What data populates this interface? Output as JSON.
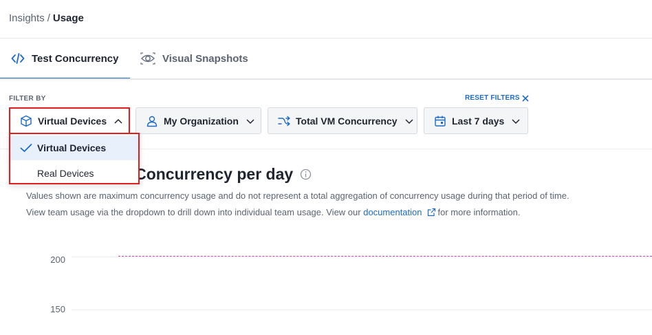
{
  "breadcrumb": {
    "parent": "Insights",
    "separator": "/",
    "current": "Usage"
  },
  "tabs": [
    {
      "label": "Test Concurrency",
      "icon": "code-icon",
      "active": true
    },
    {
      "label": "Visual Snapshots",
      "icon": "eye-icon",
      "active": false
    }
  ],
  "filters": {
    "heading": "FILTER BY",
    "reset_label": "RESET FILTERS",
    "device": {
      "label": "Virtual Devices",
      "icon": "cube-icon",
      "expanded": true
    },
    "org": {
      "label": "My Organization",
      "icon": "user-icon"
    },
    "metric": {
      "label": "Total VM Concurrency",
      "icon": "shuffle-icon"
    },
    "date": {
      "label": "Last 7 days",
      "icon": "calendar-icon"
    }
  },
  "device_dropdown": {
    "options": [
      {
        "label": "Virtual Devices",
        "selected": true
      },
      {
        "label": "Real Devices",
        "selected": false
      }
    ]
  },
  "chart": {
    "title": "Virtual Device Concurrency per day",
    "desc_line1": "Values shown are maximum concurrency usage and do not represent a total aggregation of concurrency usage during that period of time.",
    "desc_line2_before": "View team usage via the dropdown to drill down into individual team usage. View our",
    "desc_link": "documentation",
    "desc_line2_after": "for more information.",
    "y_ticks": [
      "200",
      "150"
    ]
  },
  "colors": {
    "accent": "#1b6ac9",
    "highlight_border": "#e11d1d",
    "limit_line": "#c74ab0"
  }
}
